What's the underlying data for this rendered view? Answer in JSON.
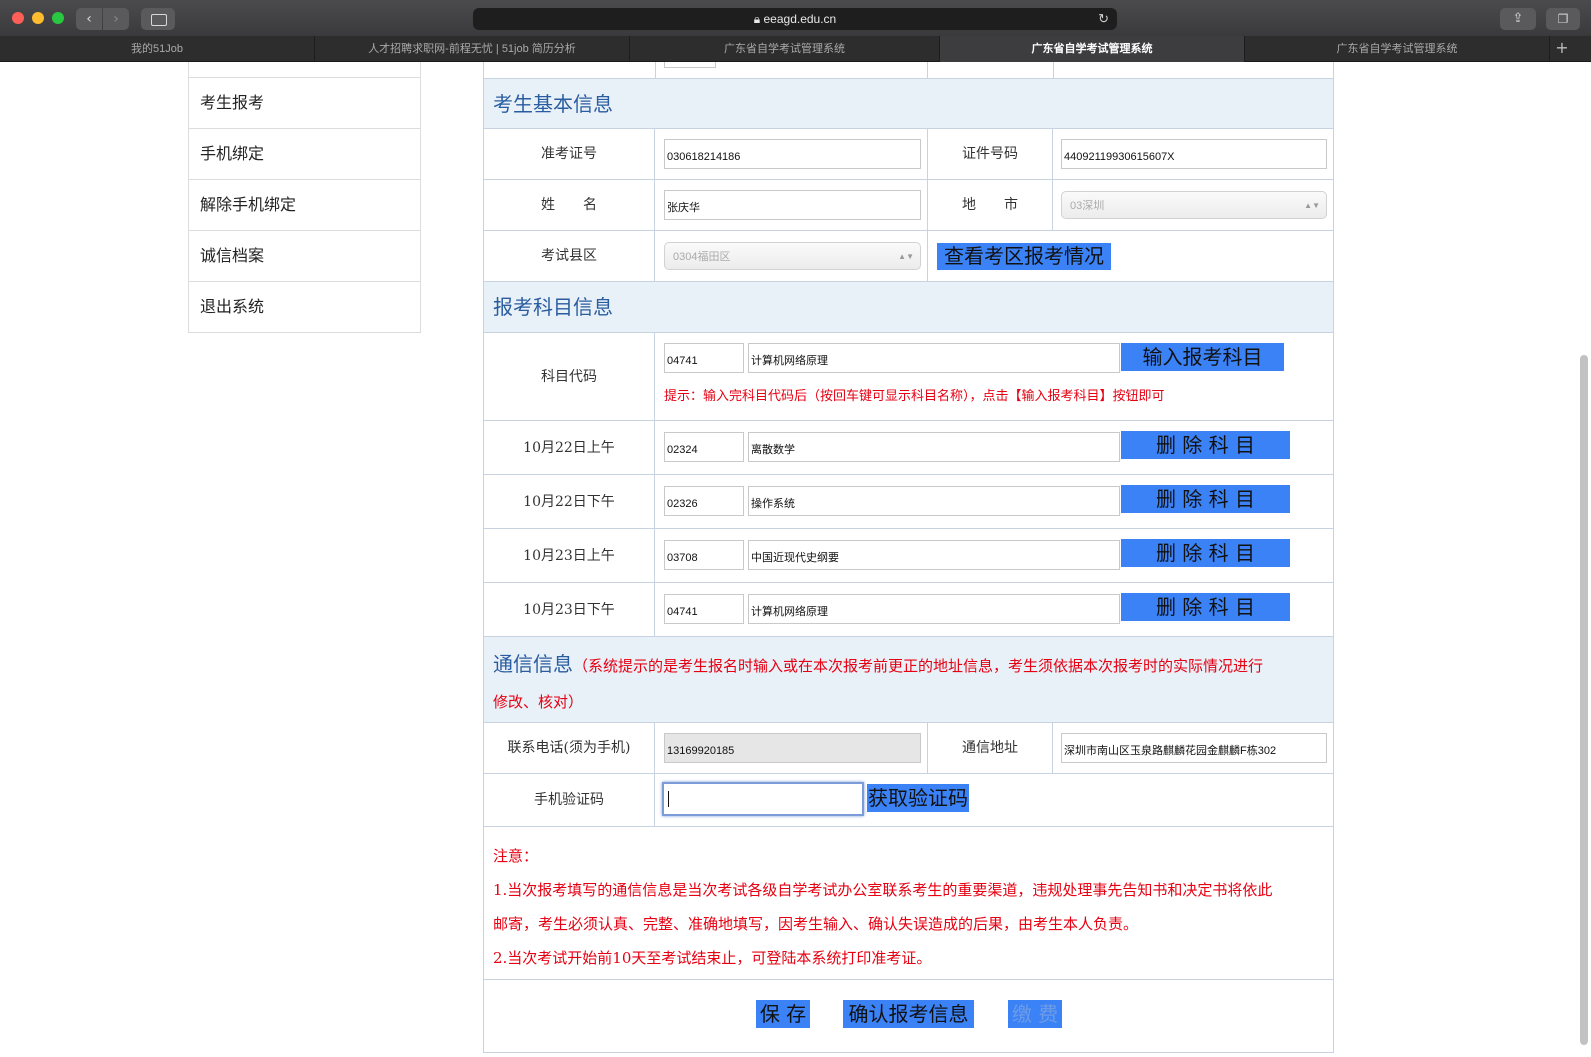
{
  "browser": {
    "url": "eeagd.edu.cn",
    "tabs": [
      {
        "label": "我的51Job",
        "active": false
      },
      {
        "label": "人才招聘求职网-前程无忧 | 51job 简历分析",
        "active": false
      },
      {
        "label": "广东省自学考试管理系统",
        "active": false
      },
      {
        "label": "广东省自学考试管理系统",
        "active": true
      },
      {
        "label": "广东省自学考试管理系统",
        "active": false
      }
    ],
    "tab_add": "+"
  },
  "menu": {
    "items": [
      "考生报考",
      "手机绑定",
      "解除手机绑定",
      "诚信档案",
      "退出系统"
    ]
  },
  "basic_info": {
    "title": "考生基本信息",
    "admission_label": "准考证号",
    "admission_value": "030618214186",
    "id_label": "证件号码",
    "id_value": "44092119930615607X",
    "name_label": "姓　　名",
    "name_value": "张庆华",
    "city_label": "地　　市",
    "city_value": "03深圳",
    "district_label": "考试县区",
    "district_value": "0304福田区",
    "view_district_button": "查看考区报考情况"
  },
  "subjects": {
    "title": "报考科目信息",
    "code_label": "科目代码",
    "code_input": "04741",
    "name_input": "计算机网络原理",
    "add_button": "输入报考科目",
    "hint": "提示：输入完科目代码后（按回车键可显示科目名称），点击【输入报考科目】按钮即可",
    "delete_button": "删 除 科 目",
    "rows": [
      {
        "time": "10月22日上午",
        "code": "02324",
        "name": "离散数学"
      },
      {
        "time": "10月22日下午",
        "code": "02326",
        "name": "操作系统"
      },
      {
        "time": "10月23日上午",
        "code": "03708",
        "name": "中国近现代史纲要"
      },
      {
        "time": "10月23日下午",
        "code": "04741",
        "name": "计算机网络原理"
      }
    ]
  },
  "contact": {
    "title": "通信信息",
    "note_line1": "（系统提示的是考生报名时输入或在本次报考前更正的地址信息，考生须依据本次报考时的实际情况进行",
    "note_line2": "修改、核对）",
    "phone_label": "联系电话(须为手机)",
    "phone_value": "13169920185",
    "address_label": "通信地址",
    "address_value": "深圳市南山区玉泉路麒麟花园金麒麟F栋302",
    "code_label": "手机验证码",
    "code_value": "",
    "get_code_button": "获取验证码"
  },
  "notice": {
    "heading": "注意：",
    "line1": "1.当次报考填写的通信信息是当次考试各级自学考试办公室联系考生的重要渠道，违规处理事先告知书和决定书将依此",
    "line2": "邮寄，考生必须认真、完整、准确地填写，因考生输入、确认失误造成的后果，由考生本人负责。",
    "line3": "2.当次考试开始前10天至考试结束止，可登陆本系统打印准考证。"
  },
  "actions": {
    "save": "保 存",
    "confirm": "确认报考信息",
    "pay": "缴 费"
  },
  "colors": {
    "accent_blue": "#3b82f6",
    "section_bg": "#e8f0f8",
    "section_text": "#2a5d9f",
    "warning_red": "#e60012"
  }
}
